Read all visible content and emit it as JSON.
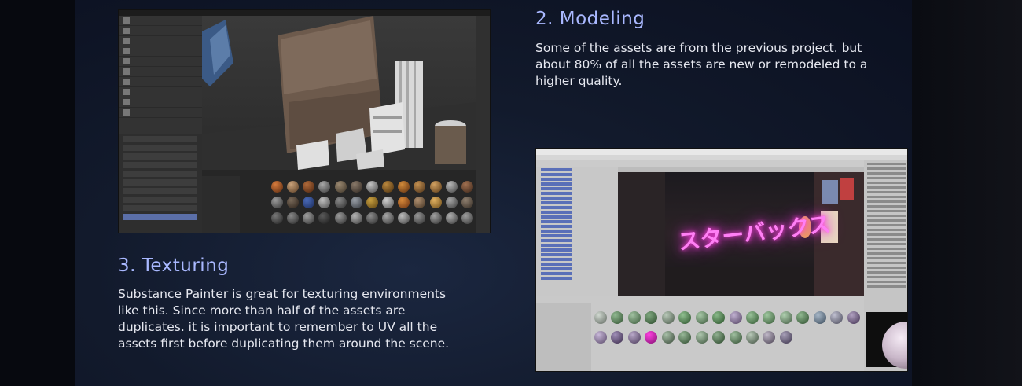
{
  "sections": {
    "modeling": {
      "heading": "2. Modeling",
      "body": "Some of the assets are from the previous project. but about 80% of all the assets are new or remodeled to a higher quality."
    },
    "texturing": {
      "heading": "3. Texturing",
      "body": "Substance Painter is great for texturing environments like this. Since more than half of the assets are duplicates. it is important to remember to UV all the assets first before duplicating them around the scene."
    }
  },
  "images": {
    "texturing_screenshot": {
      "depicts": "substance-painter-ui"
    },
    "modeling_screenshot": {
      "depicts": "unity-editor-ui",
      "neon_sign": "スターバックス"
    }
  },
  "colors": {
    "heading": "#a9b8ff",
    "body_text": "#e6e8f0",
    "panel_bg": "#142036"
  }
}
